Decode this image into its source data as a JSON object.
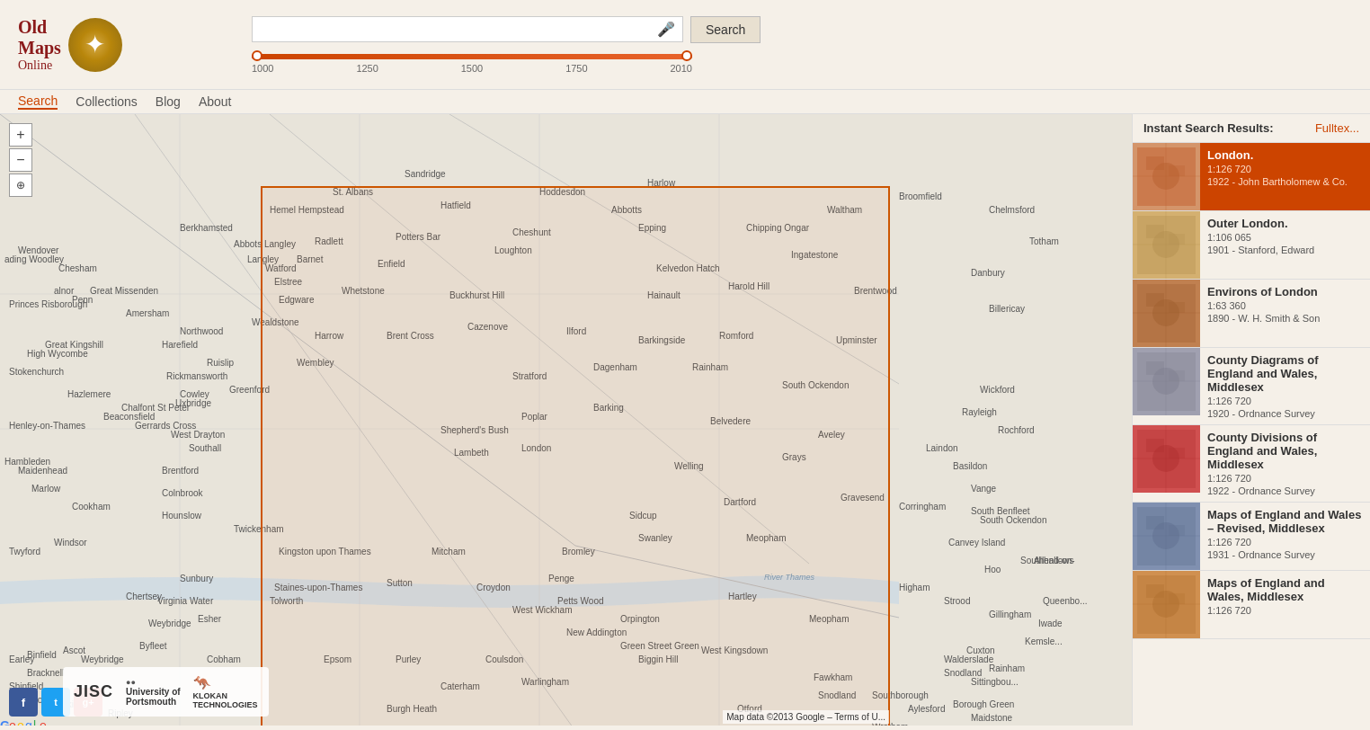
{
  "header": {
    "logo": {
      "line1": "Old",
      "line2": "Maps",
      "line3": "Online"
    },
    "search": {
      "placeholder": "",
      "value": "",
      "button_label": "Search",
      "mic_symbol": "🎤"
    },
    "year_range": {
      "min": "1000",
      "marks": [
        "1000",
        "1250",
        "1500",
        "1750",
        "2010"
      ],
      "max": "2010"
    }
  },
  "nav": {
    "items": [
      {
        "label": "Search",
        "active": true
      },
      {
        "label": "Collections",
        "active": false
      },
      {
        "label": "Blog",
        "active": false
      },
      {
        "label": "About",
        "active": false
      }
    ]
  },
  "sidebar": {
    "instant_search_label": "Instant Search Results:",
    "fulltext_label": "Fulltex...",
    "results": [
      {
        "title": "London.",
        "scale": "1:126 720",
        "date": "1922",
        "author": "John Bartholomew & Co.",
        "highlighted": true
      },
      {
        "title": "Outer London.",
        "scale": "1:106 065",
        "date": "1901",
        "author": "Stanford, Edward",
        "highlighted": false
      },
      {
        "title": "Environs of London",
        "scale": "1:63 360",
        "date": "1890",
        "author": "W. H. Smith & Son",
        "highlighted": false
      },
      {
        "title": "County Diagrams of England and Wales, Middlesex",
        "scale": "1:126 720",
        "date": "1920",
        "author": "Ordnance Survey",
        "highlighted": false
      },
      {
        "title": "County Divisions of England and Wales, Middlesex",
        "scale": "1:126 720",
        "date": "1922",
        "author": "Ordnance Survey",
        "highlighted": false
      },
      {
        "title": "Maps of England and Wales – Revised, Middlesex",
        "scale": "1:126 720",
        "date": "1931",
        "author": "Ordnance Survey",
        "highlighted": false
      },
      {
        "title": "Maps of England and Wales, Middlesex",
        "scale": "1:126 720",
        "date": "",
        "author": "",
        "highlighted": false
      }
    ]
  },
  "map": {
    "attribution": "Map data ©2013 Google – Terms of U...",
    "zoom_in": "+",
    "zoom_out": "−",
    "zoom_icon": "⊕"
  },
  "footer": {
    "logos": [
      {
        "label": "JISC",
        "type": "text"
      },
      {
        "label": "University of Portsmouth",
        "type": "text"
      },
      {
        "label": "KLOKAN TECHNOLOGIES",
        "type": "text"
      }
    ],
    "social": [
      {
        "label": "f",
        "type": "facebook"
      },
      {
        "label": "t",
        "type": "twitter"
      },
      {
        "label": "g+",
        "type": "googleplus"
      }
    ]
  }
}
